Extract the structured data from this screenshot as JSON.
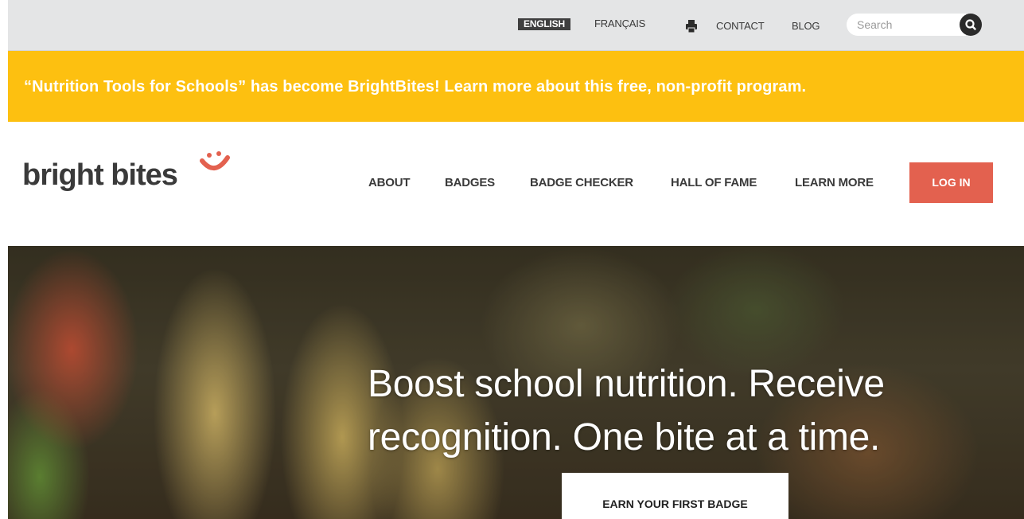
{
  "utility_bar": {
    "language_active": "ENGLISH",
    "language_other": "FRANÇAIS",
    "print_icon": "printer-icon",
    "contact_label": "CONTACT",
    "blog_label": "BLOG",
    "search_placeholder": "Search",
    "search_icon": "search-icon"
  },
  "announcement": {
    "text": "“Nutrition Tools for Schools” has become BrightBites! Learn more about this free, non-profit program."
  },
  "header": {
    "logo_text": "bright bites",
    "logo_icon": "smile-icon",
    "nav": [
      {
        "label": "ABOUT"
      },
      {
        "label": "BADGES"
      },
      {
        "label": "BADGE CHECKER"
      },
      {
        "label": "HALL OF FAME"
      },
      {
        "label": "LEARN MORE"
      }
    ],
    "login_label": "LOG IN"
  },
  "hero": {
    "headline": "Boost school nutrition. Receive recognition. One bite at a time.",
    "cta_label": "EARN YOUR FIRST BADGE"
  },
  "colors": {
    "utility_bg": "#e4e5e6",
    "banner": "#fdc010",
    "brand_red": "#e3614f",
    "text_dark": "#3a3a3a"
  }
}
